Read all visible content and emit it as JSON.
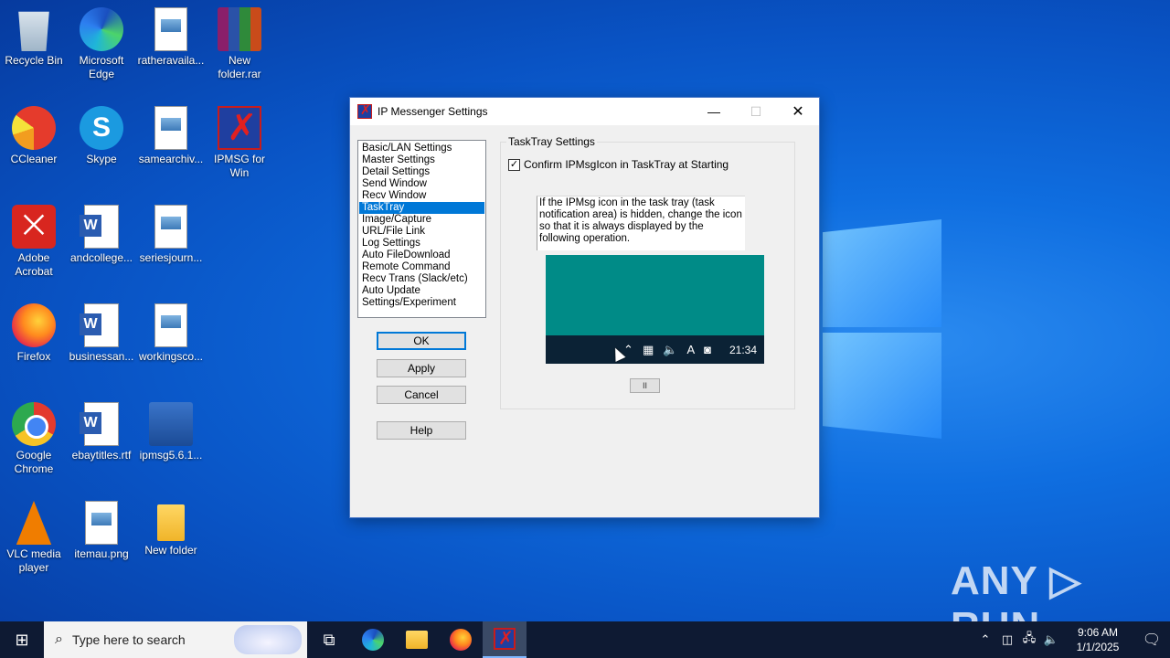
{
  "desktop": {
    "icons": [
      {
        "label": "Recycle Bin"
      },
      {
        "label": "Microsoft Edge"
      },
      {
        "label": "ratheravaila..."
      },
      {
        "label": "New folder.rar"
      },
      {
        "label": "CCleaner"
      },
      {
        "label": "Skype"
      },
      {
        "label": "samearchiv..."
      },
      {
        "label": "IPMSG for Win"
      },
      {
        "label": "Adobe Acrobat"
      },
      {
        "label": "andcollege..."
      },
      {
        "label": "seriesjourn..."
      },
      {
        "label": "Firefox"
      },
      {
        "label": "businessan..."
      },
      {
        "label": "workingsco..."
      },
      {
        "label": "Google Chrome"
      },
      {
        "label": "ebaytitles.rtf"
      },
      {
        "label": "ipmsg5.6.1..."
      },
      {
        "label": "VLC media player"
      },
      {
        "label": "itemau.png"
      },
      {
        "label": "New folder"
      }
    ],
    "watermark": "ANY ▷ RUN"
  },
  "dialog": {
    "title": "IP Messenger Settings",
    "nav_items": [
      {
        "label": "Basic/LAN Settings"
      },
      {
        "label": "Master Settings"
      },
      {
        "label": "Detail Settings"
      },
      {
        "label": "Send Window"
      },
      {
        "label": "Recv Window"
      },
      {
        "label": "TaskTray"
      },
      {
        "label": "Image/Capture"
      },
      {
        "label": "URL/File Link"
      },
      {
        "label": "Log Settings"
      },
      {
        "label": "Auto FileDownload"
      },
      {
        "label": "Remote Command"
      },
      {
        "label": "Recv Trans (Slack/etc)"
      },
      {
        "label": "Auto Update"
      },
      {
        "label": "Settings/Experiment"
      }
    ],
    "selected_nav": "TaskTray",
    "buttons": {
      "ok": "OK",
      "apply": "Apply",
      "cancel": "Cancel",
      "help": "Help"
    },
    "group": {
      "label": "TaskTray Settings",
      "checkbox_label": "Confirm IPMsgIcon in TaskTray at Starting",
      "checkbox_checked": true,
      "description": "If the IPMsg icon in the task tray (task notification area) is hidden, change the icon so that it is always displayed by the following operation.",
      "preview_time": "21:34",
      "pause_label": "II"
    }
  },
  "taskbar": {
    "search_placeholder": "Type here to search",
    "clock_time": "9:06 AM",
    "clock_date": "1/1/2025"
  }
}
